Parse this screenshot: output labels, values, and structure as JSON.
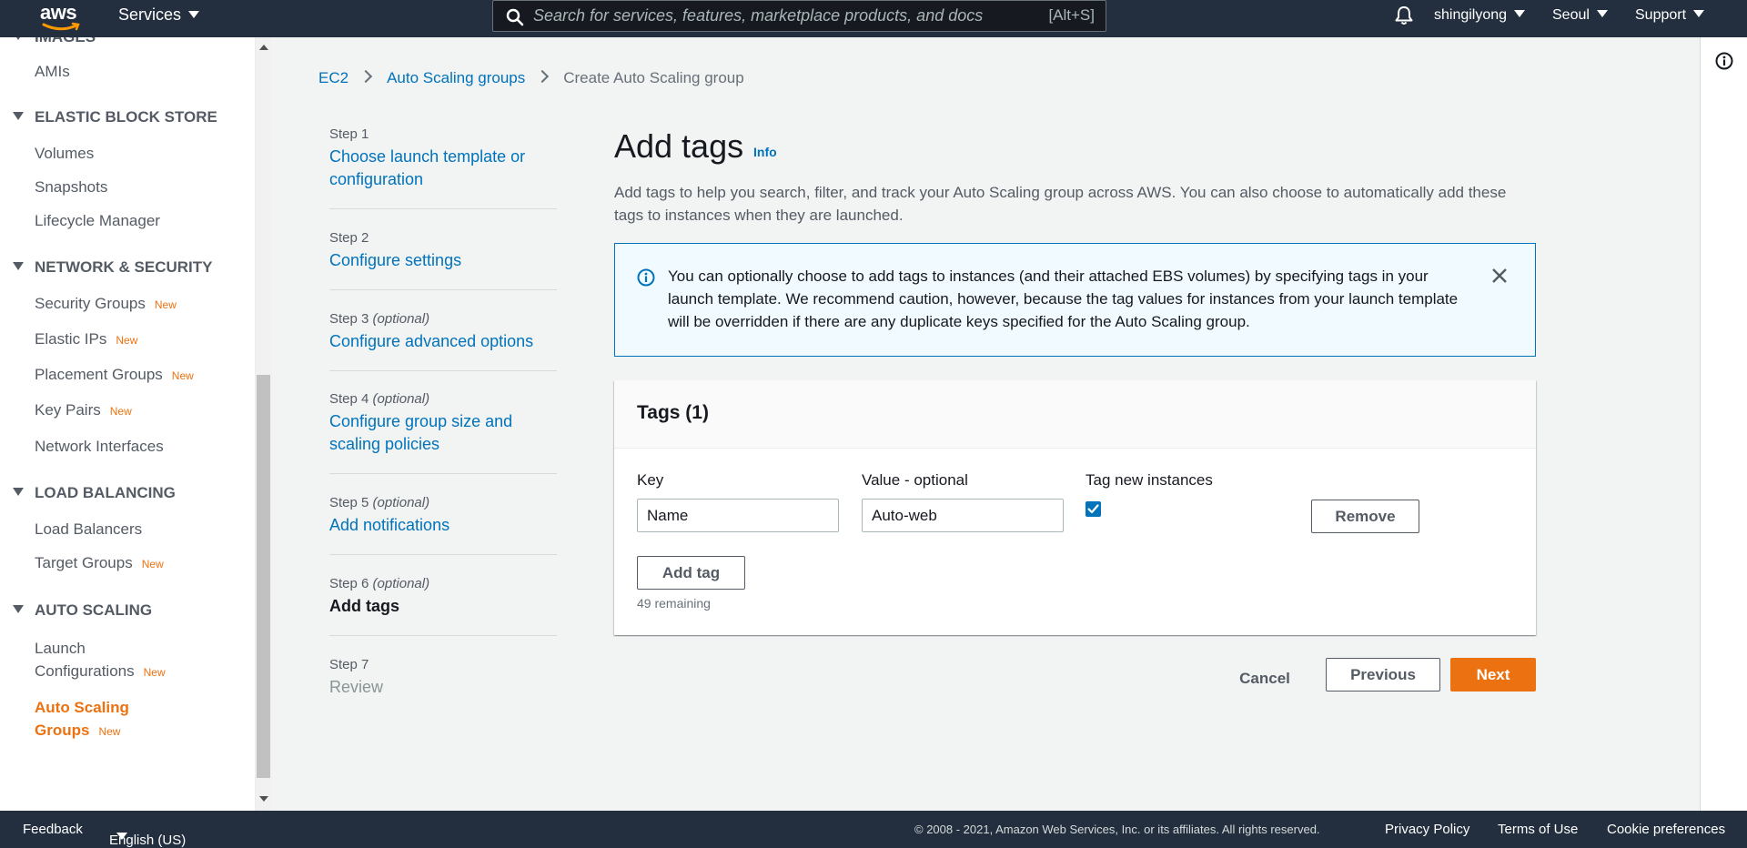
{
  "topnav": {
    "logo_text": "aws",
    "services_label": "Services",
    "search_placeholder": "Search for services, features, marketplace products, and docs",
    "search_hint": "[Alt+S]",
    "user": "shingilyong",
    "region": "Seoul",
    "support": "Support"
  },
  "sidebar": {
    "cut_off_item": "IMAGES",
    "amis": "AMIs",
    "ebs_head": "ELASTIC BLOCK STORE",
    "volumes": "Volumes",
    "snapshots": "Snapshots",
    "lifecycle": "Lifecycle Manager",
    "netsec_head": "NETWORK & SECURITY",
    "security_groups": "Security Groups",
    "elastic_ips": "Elastic IPs",
    "placement_groups": "Placement Groups",
    "key_pairs": "Key Pairs",
    "network_interfaces": "Network Interfaces",
    "lb_head": "LOAD BALANCING",
    "load_balancers": "Load Balancers",
    "target_groups": "Target Groups",
    "as_head": "AUTO SCALING",
    "launch_config_1": "Launch",
    "launch_config_2": "Configurations",
    "asg_1": "Auto Scaling",
    "asg_2": "Groups",
    "new_badge": "New"
  },
  "breadcrumb": {
    "ec2": "EC2",
    "asg": "Auto Scaling groups",
    "current": "Create Auto Scaling group"
  },
  "steps": {
    "optional": "(optional)",
    "s1_label": "Step 1",
    "s1_name_1": "Choose launch template or",
    "s1_name_2": "configuration",
    "s2_label": "Step 2",
    "s2_name": "Configure settings",
    "s3_label": "Step 3",
    "s3_name": "Configure advanced options",
    "s4_label": "Step 4",
    "s4_name_1": "Configure group size and",
    "s4_name_2": "scaling policies",
    "s5_label": "Step 5",
    "s5_name": "Add notifications",
    "s6_label": "Step 6",
    "s6_name": "Add tags",
    "s7_label": "Step 7",
    "s7_name": "Review"
  },
  "main": {
    "title": "Add tags",
    "info": "Info",
    "description": "Add tags to help you search, filter, and track your Auto Scaling group across AWS. You can also choose to automatically add these tags to instances when they are launched.",
    "alert_text": "You can optionally choose to add tags to instances (and their attached EBS volumes) by specifying tags in your launch template. We recommend caution, however, because the tag values for instances from your launch template will be overridden if there are any duplicate keys specified for the Auto Scaling group."
  },
  "tags": {
    "header": "Tags (1)",
    "key_label": "Key",
    "value_label": "Value - optional",
    "tag_new_label": "Tag new instances",
    "key_value": "Name",
    "value_value": "Auto-web",
    "tag_new_checked": true,
    "remove": "Remove",
    "add_tag": "Add tag",
    "remaining": "49 remaining"
  },
  "actions": {
    "cancel": "Cancel",
    "previous": "Previous",
    "next": "Next"
  },
  "footer": {
    "feedback": "Feedback",
    "language": "English (US)",
    "copyright": "© 2008 - 2021, Amazon Web Services, Inc. or its affiliates. All rights reserved.",
    "privacy": "Privacy Policy",
    "terms": "Terms of Use",
    "cookies": "Cookie preferences"
  },
  "colors": {
    "nav_bg": "#232f3e",
    "link": "#0073bb",
    "accent": "#ec7211",
    "alert_bg": "#f1faff"
  }
}
